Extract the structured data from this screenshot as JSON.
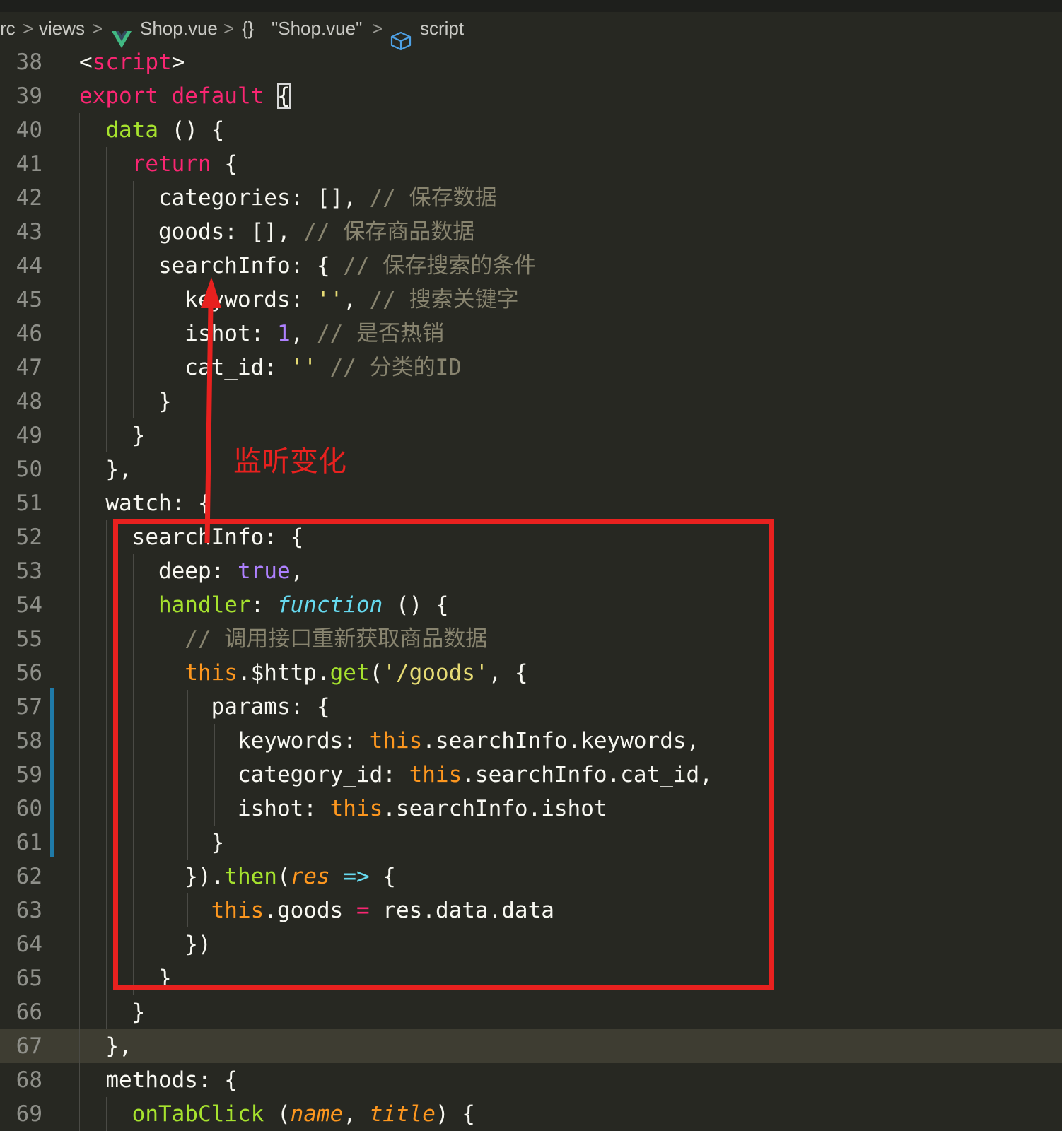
{
  "breadcrumb": {
    "items": [
      "rc",
      "views",
      "Shop.vue",
      "{}",
      "\"Shop.vue\"",
      "script"
    ],
    "separator": ">"
  },
  "colors": {
    "background": "#272822",
    "keyword": "#f92672",
    "function": "#a6e22e",
    "comment": "#88846f",
    "string": "#e6db74",
    "number": "#ae81ff",
    "this": "#fd971f",
    "storage": "#66d9ef",
    "annotation": "#e8211f"
  },
  "editor": {
    "highlighted_line": 67,
    "lines": [
      {
        "n": 38,
        "tokens": [
          {
            "t": "<"
          },
          {
            "t": "script",
            "c": "tag"
          },
          {
            "t": ">"
          }
        ]
      },
      {
        "n": 39,
        "tokens": [
          {
            "t": "export default ",
            "c": "kw"
          },
          {
            "t": "{",
            "c": "box"
          }
        ]
      },
      {
        "n": 40,
        "tokens": [
          {
            "t": "  "
          },
          {
            "t": "data",
            "c": "fn"
          },
          {
            "t": " () {"
          }
        ]
      },
      {
        "n": 41,
        "tokens": [
          {
            "t": "    "
          },
          {
            "t": "return",
            "c": "kw"
          },
          {
            "t": " {"
          }
        ]
      },
      {
        "n": 42,
        "tokens": [
          {
            "t": "      categories: [], "
          },
          {
            "t": "// 保存数据",
            "c": "cm"
          }
        ]
      },
      {
        "n": 43,
        "tokens": [
          {
            "t": "      goods: [], "
          },
          {
            "t": "// 保存商品数据",
            "c": "cm"
          }
        ]
      },
      {
        "n": 44,
        "tokens": [
          {
            "t": "      searchInfo: { "
          },
          {
            "t": "// 保存搜索的条件",
            "c": "cm"
          }
        ]
      },
      {
        "n": 45,
        "tokens": [
          {
            "t": "        keywords: "
          },
          {
            "t": "''",
            "c": "str"
          },
          {
            "t": ", "
          },
          {
            "t": "// 搜索关键字",
            "c": "cm"
          }
        ]
      },
      {
        "n": 46,
        "tokens": [
          {
            "t": "        ishot: "
          },
          {
            "t": "1",
            "c": "num"
          },
          {
            "t": ", "
          },
          {
            "t": "// 是否热销",
            "c": "cm"
          }
        ]
      },
      {
        "n": 47,
        "tokens": [
          {
            "t": "        cat_id: "
          },
          {
            "t": "''",
            "c": "str"
          },
          {
            "t": " "
          },
          {
            "t": "// 分类的ID",
            "c": "cm"
          }
        ]
      },
      {
        "n": 48,
        "tokens": [
          {
            "t": "      }"
          }
        ]
      },
      {
        "n": 49,
        "tokens": [
          {
            "t": "    }"
          }
        ]
      },
      {
        "n": 50,
        "tokens": [
          {
            "t": "  },"
          }
        ]
      },
      {
        "n": 51,
        "tokens": [
          {
            "t": "  watch: {"
          }
        ]
      },
      {
        "n": 52,
        "tokens": [
          {
            "t": "    searchInfo: {"
          }
        ]
      },
      {
        "n": 53,
        "tokens": [
          {
            "t": "      deep: "
          },
          {
            "t": "true",
            "c": "num"
          },
          {
            "t": ","
          }
        ]
      },
      {
        "n": 54,
        "tokens": [
          {
            "t": "      "
          },
          {
            "t": "handler",
            "c": "fn"
          },
          {
            "t": ": "
          },
          {
            "t": "function",
            "c": "store"
          },
          {
            "t": " () {"
          }
        ]
      },
      {
        "n": 55,
        "tokens": [
          {
            "t": "        "
          },
          {
            "t": "// 调用接口重新获取商品数据",
            "c": "cm"
          }
        ]
      },
      {
        "n": 56,
        "tokens": [
          {
            "t": "        "
          },
          {
            "t": "this",
            "c": "this"
          },
          {
            "t": ".$http."
          },
          {
            "t": "get",
            "c": "fn"
          },
          {
            "t": "("
          },
          {
            "t": "'/goods'",
            "c": "str"
          },
          {
            "t": ", {"
          }
        ]
      },
      {
        "n": 57,
        "tokens": [
          {
            "t": "          params: {"
          }
        ]
      },
      {
        "n": 58,
        "tokens": [
          {
            "t": "            keywords: "
          },
          {
            "t": "this",
            "c": "this"
          },
          {
            "t": ".searchInfo.keywords,"
          }
        ]
      },
      {
        "n": 59,
        "tokens": [
          {
            "t": "            category_id: "
          },
          {
            "t": "this",
            "c": "this"
          },
          {
            "t": ".searchInfo.cat_id,"
          }
        ]
      },
      {
        "n": 60,
        "tokens": [
          {
            "t": "            ishot: "
          },
          {
            "t": "this",
            "c": "this"
          },
          {
            "t": ".searchInfo.ishot"
          }
        ]
      },
      {
        "n": 61,
        "tokens": [
          {
            "t": "          }"
          }
        ]
      },
      {
        "n": 62,
        "tokens": [
          {
            "t": "        })."
          },
          {
            "t": "then",
            "c": "fn"
          },
          {
            "t": "("
          },
          {
            "t": "res",
            "c": "param"
          },
          {
            "t": " "
          },
          {
            "t": "=>",
            "c": "arrow"
          },
          {
            "t": " {"
          }
        ]
      },
      {
        "n": 63,
        "tokens": [
          {
            "t": "          "
          },
          {
            "t": "this",
            "c": "this"
          },
          {
            "t": ".goods "
          },
          {
            "t": "=",
            "c": "kw"
          },
          {
            "t": " res.data.data"
          }
        ]
      },
      {
        "n": 64,
        "tokens": [
          {
            "t": "        })"
          }
        ]
      },
      {
        "n": 65,
        "tokens": [
          {
            "t": "      }"
          }
        ]
      },
      {
        "n": 66,
        "tokens": [
          {
            "t": "    }"
          }
        ]
      },
      {
        "n": 67,
        "tokens": [
          {
            "t": "  },"
          }
        ]
      },
      {
        "n": 68,
        "tokens": [
          {
            "t": "  methods: {"
          }
        ]
      },
      {
        "n": 69,
        "tokens": [
          {
            "t": "    "
          },
          {
            "t": "onTabClick",
            "c": "fn"
          },
          {
            "t": " ("
          },
          {
            "t": "name",
            "c": "param"
          },
          {
            "t": ", "
          },
          {
            "t": "title",
            "c": "param"
          },
          {
            "t": ") {"
          }
        ]
      }
    ]
  },
  "annotation": {
    "label": "监听变化"
  }
}
